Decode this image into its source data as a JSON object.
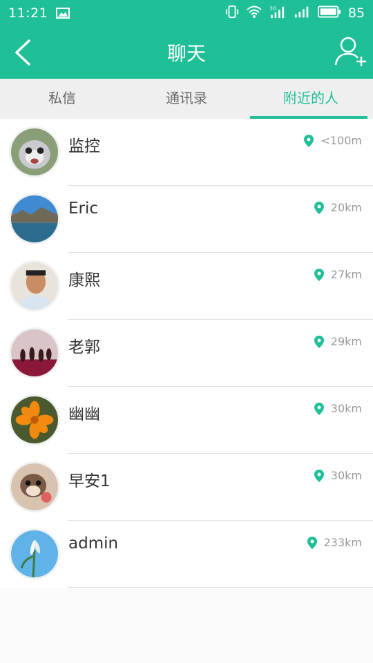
{
  "status_bar": {
    "time": "11:21",
    "battery": "85",
    "network": "3G"
  },
  "header": {
    "title": "聊天"
  },
  "tabs": [
    {
      "label": "私信",
      "active": false
    },
    {
      "label": "通讯录",
      "active": false
    },
    {
      "label": "附近的人",
      "active": true
    }
  ],
  "people": [
    {
      "name": "监控",
      "distance": "<100m"
    },
    {
      "name": "Eric",
      "distance": "20km"
    },
    {
      "name": "康熙",
      "distance": "27km"
    },
    {
      "name": "老郭",
      "distance": "29km"
    },
    {
      "name": "幽幽",
      "distance": "30km"
    },
    {
      "name": "早安1",
      "distance": "30km"
    },
    {
      "name": "admin",
      "distance": "233km"
    }
  ],
  "colors": {
    "accent": "#1fbf97",
    "tab_bg": "#efefef",
    "text": "#333333",
    "muted": "#999999"
  },
  "icons": {
    "back": "chevron-left-icon",
    "add_user": "add-user-icon",
    "distance": "location-pin-icon"
  }
}
